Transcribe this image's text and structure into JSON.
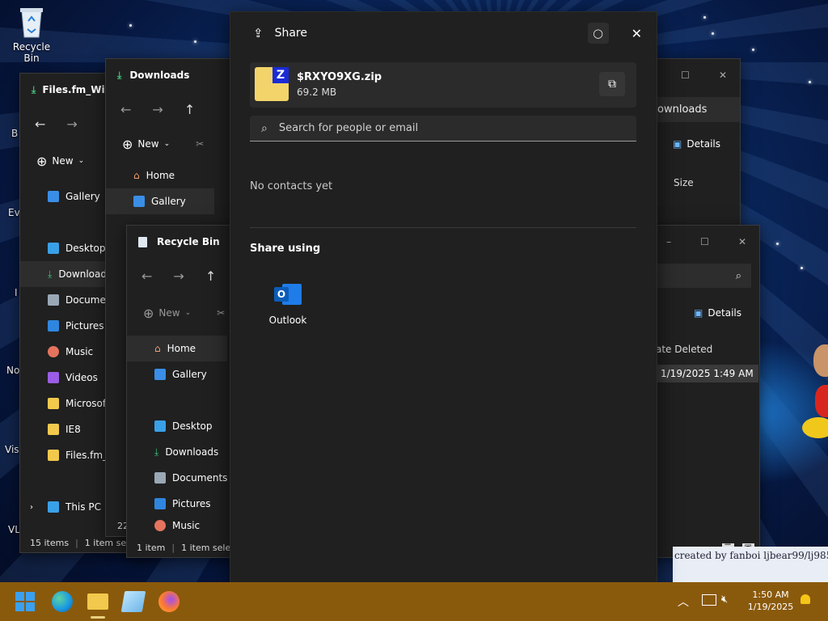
{
  "desktop": {
    "recycle_bin_label": "Recycle Bin",
    "partial_labels": [
      "B",
      "Ev",
      "I",
      "No",
      "Visu",
      "VL"
    ]
  },
  "win_files": {
    "title": "Files.fm_Wi",
    "new_label": "New",
    "sidebar": [
      "Gallery",
      "Desktop",
      "Downloads",
      "Documents",
      "Pictures",
      "Music",
      "Videos",
      "Microsoft",
      "IE8",
      "Files.fm_W",
      "This PC"
    ],
    "status_items": "15 items",
    "status_sel": "1 item sele"
  },
  "win_downloads": {
    "title": "Downloads",
    "new_label": "New",
    "sidebar": [
      "Home",
      "Gallery"
    ],
    "status": "22",
    "address": "Downloads",
    "details_label": "Details",
    "col_size": "Size"
  },
  "win_recycle": {
    "title": "Recycle Bin",
    "new_label": "New",
    "sidebar": [
      "Home",
      "Gallery",
      "Desktop",
      "Downloads",
      "Documents",
      "Pictures",
      "Music"
    ],
    "status_items": "1 item",
    "status_sel": "1 item selec",
    "details_label": "Details",
    "col_date": "ate Deleted",
    "row_date": "1/19/2025 1:49 AM"
  },
  "share": {
    "title": "Share",
    "file_name": "$RXYO9XG.zip",
    "file_size": "69.2 MB",
    "search_placeholder": "Search for people or email",
    "no_contacts": "No contacts yet",
    "share_using": "Share using",
    "apps": [
      {
        "label": "Outlook",
        "icon": "outlook-icon"
      }
    ]
  },
  "watermark": "created by fanboi ljbear99/lj985",
  "taskbar": {
    "time": "1:50 AM",
    "date": "1/19/2025",
    "apps": [
      "start-icon",
      "edge-icon",
      "file-explorer-icon",
      "notepad-icon",
      "firefox-icon"
    ]
  },
  "colors": {
    "taskbar": "#8a5a0c",
    "accent": "#0078d4",
    "window": "#202020"
  }
}
